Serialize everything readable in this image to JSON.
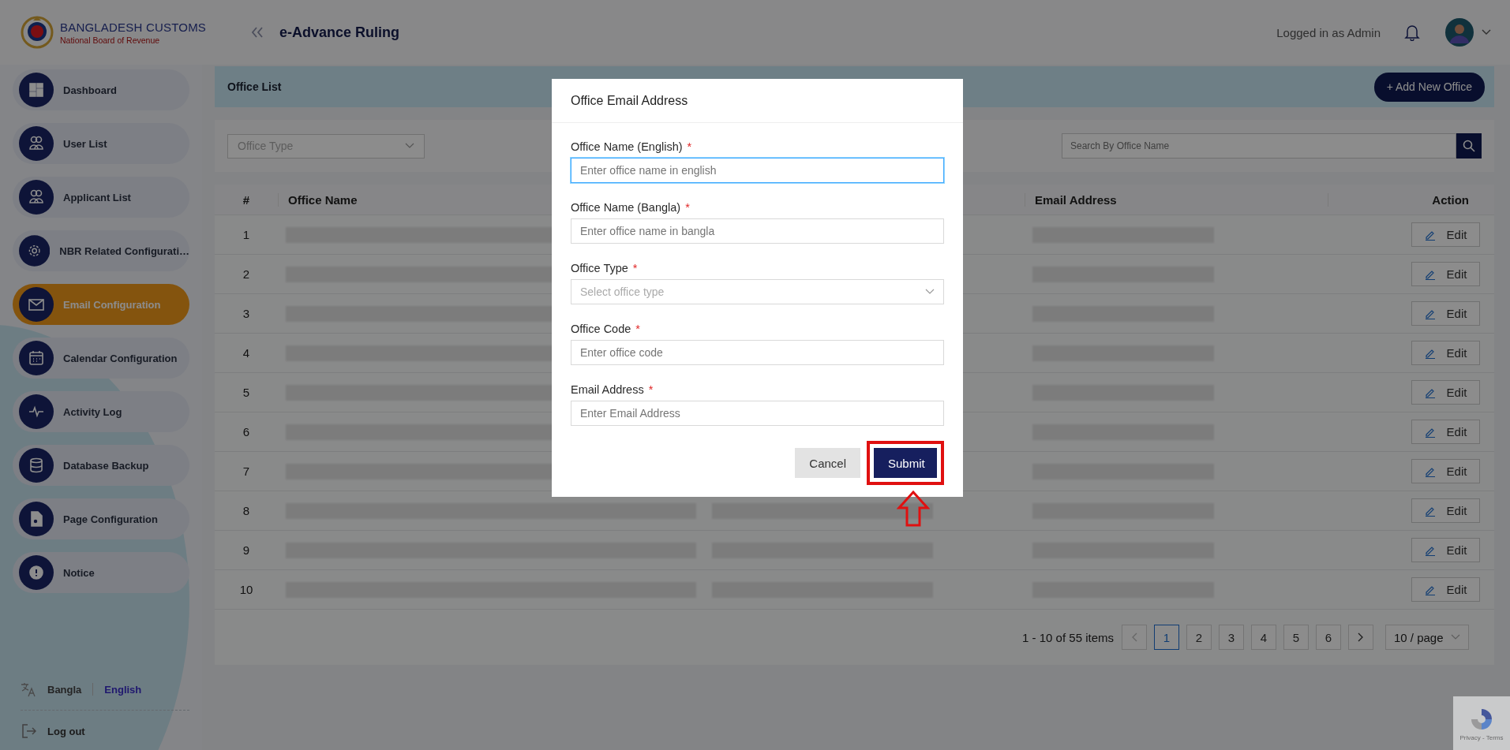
{
  "header": {
    "brand_title": "BANGLADESH CUSTOMS",
    "brand_subtitle": "National Board of Revenue",
    "app_title": "e-Advance Ruling",
    "user_label": "Logged in as Admin"
  },
  "sidebar": {
    "items": [
      {
        "label": "Dashboard",
        "selected": false
      },
      {
        "label": "User List",
        "selected": false
      },
      {
        "label": "Applicant List",
        "selected": false
      },
      {
        "label": "NBR Related Configurati…",
        "selected": false
      },
      {
        "label": "Email Configuration",
        "selected": true
      },
      {
        "label": "Calendar Configuration",
        "selected": false
      },
      {
        "label": "Activity Log",
        "selected": false
      },
      {
        "label": "Database Backup",
        "selected": false
      },
      {
        "label": "Page Configuration",
        "selected": false
      },
      {
        "label": "Notice",
        "selected": false
      }
    ],
    "languages": [
      {
        "label": "Bangla",
        "selected": false
      },
      {
        "label": "English",
        "selected": true
      }
    ],
    "logout": "Log out"
  },
  "page": {
    "title": "Office List",
    "add_button": "+ Add New Office"
  },
  "filters": {
    "office_type_placeholder": "Office Type",
    "search_placeholder": "Search By Office Name"
  },
  "table": {
    "columns": [
      "#",
      "Office Name",
      "Email Address",
      "Action"
    ],
    "rows": [
      {
        "index": "1",
        "action": "Edit"
      },
      {
        "index": "2",
        "action": "Edit"
      },
      {
        "index": "3",
        "action": "Edit"
      },
      {
        "index": "4",
        "action": "Edit"
      },
      {
        "index": "5",
        "action": "Edit"
      },
      {
        "index": "6",
        "action": "Edit"
      },
      {
        "index": "7",
        "action": "Edit"
      },
      {
        "index": "8",
        "action": "Edit"
      },
      {
        "index": "9",
        "action": "Edit"
      },
      {
        "index": "10",
        "action": "Edit"
      }
    ]
  },
  "pagination": {
    "summary": "1 - 10 of 55 items",
    "pages": [
      {
        "label": "1",
        "selected": true
      },
      {
        "label": "2",
        "selected": false
      },
      {
        "label": "3",
        "selected": false
      },
      {
        "label": "4",
        "selected": false
      },
      {
        "label": "5",
        "selected": false
      },
      {
        "label": "6",
        "selected": false
      }
    ],
    "page_size": "10 / page"
  },
  "modal": {
    "title": "Office Email Address",
    "fields": [
      {
        "kind": "input",
        "label": "Office Name (English)",
        "required_mark": "*",
        "placeholder": "Enter office name in english",
        "focused": true
      },
      {
        "kind": "input",
        "label": "Office Name (Bangla)",
        "required_mark": "*",
        "placeholder": "Enter office name in bangla",
        "focused": false
      },
      {
        "kind": "select",
        "label": "Office Type",
        "required_mark": "*",
        "placeholder": "Select office type",
        "focused": false
      },
      {
        "kind": "input",
        "label": "Office Code",
        "required_mark": "*",
        "placeholder": "Enter office code",
        "focused": false
      },
      {
        "kind": "input",
        "label": "Email Address",
        "required_mark": "*",
        "placeholder": "Enter Email Address",
        "focused": false
      }
    ],
    "buttons": [
      {
        "label": "Cancel",
        "kind": "secondary"
      },
      {
        "label": "Submit",
        "kind": "primary"
      }
    ]
  },
  "recaptcha": {
    "text": "Privacy - Terms"
  }
}
